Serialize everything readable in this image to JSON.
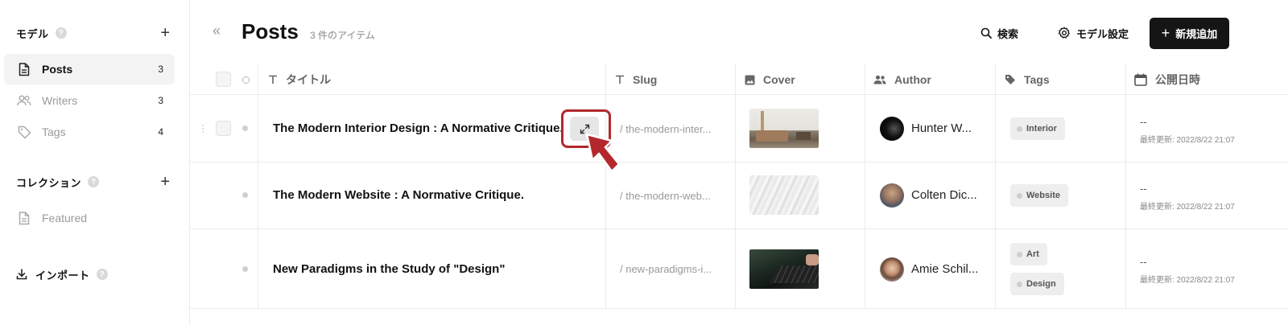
{
  "sidebar": {
    "models_heading": "モデル",
    "items": [
      {
        "label": "Posts",
        "count": "3"
      },
      {
        "label": "Writers",
        "count": "3"
      },
      {
        "label": "Tags",
        "count": "4"
      }
    ],
    "collections_heading": "コレクション",
    "collection_items": [
      {
        "label": "Featured"
      }
    ],
    "import_label": "インポート",
    "help_glyph": "?"
  },
  "header": {
    "collapse_glyph": "«",
    "title": "Posts",
    "item_count": "3 件のアイテム",
    "search_label": "検索",
    "model_settings_label": "モデル設定",
    "new_button_label": "新規追加"
  },
  "table": {
    "columns": [
      {
        "label": "タイトル",
        "icon": "text-type-icon"
      },
      {
        "label": "Slug",
        "icon": "text-type-icon"
      },
      {
        "label": "Cover",
        "icon": "image-icon"
      },
      {
        "label": "Author",
        "icon": "users-icon"
      },
      {
        "label": "Tags",
        "icon": "tag-icon"
      },
      {
        "label": "公開日時",
        "icon": "calendar-icon"
      }
    ],
    "rows": [
      {
        "title": "The Modern Interior Design : A Normative Critique.",
        "slug": "/ the-modern-inter...",
        "author": "Hunter W...",
        "tags": [
          "Interior"
        ],
        "published": "--",
        "updated": "最終更新: 2022/8/22 21:07"
      },
      {
        "title": "The Modern Website : A Normative Critique.",
        "slug": "/ the-modern-web...",
        "author": "Colten Dic...",
        "tags": [
          "Website"
        ],
        "published": "--",
        "updated": "最終更新: 2022/8/22 21:07"
      },
      {
        "title": "New Paradigms in the Study of \"Design\"",
        "slug": "/ new-paradigms-i...",
        "author": "Amie Schil...",
        "tags": [
          "Art",
          "Design"
        ],
        "published": "--",
        "updated": "最終更新: 2022/8/22 21:07"
      }
    ]
  },
  "colors": {
    "accent": "#151515",
    "highlight": "#b3282c",
    "muted": "#9a9a9a"
  }
}
